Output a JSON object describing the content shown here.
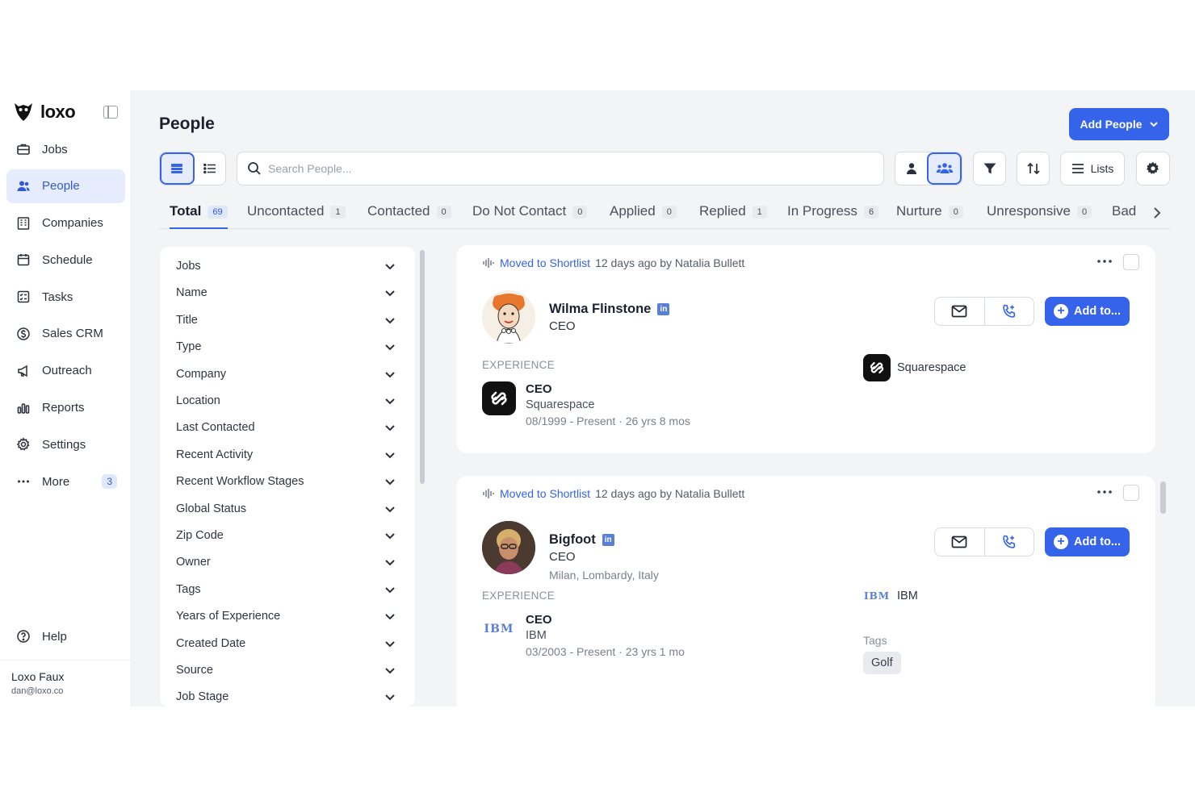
{
  "brand": {
    "name": "loxo"
  },
  "sidebar": {
    "items": [
      {
        "label": "Jobs",
        "icon": "briefcase-icon"
      },
      {
        "label": "People",
        "icon": "people-icon"
      },
      {
        "label": "Companies",
        "icon": "building-icon"
      },
      {
        "label": "Schedule",
        "icon": "calendar-icon"
      },
      {
        "label": "Tasks",
        "icon": "tasks-icon"
      },
      {
        "label": "Sales CRM",
        "icon": "dollar-icon"
      },
      {
        "label": "Outreach",
        "icon": "megaphone-icon"
      },
      {
        "label": "Reports",
        "icon": "bar-chart-icon"
      },
      {
        "label": "Settings",
        "icon": "gear-icon"
      },
      {
        "label": "More",
        "icon": "more-icon",
        "badge": "3"
      }
    ],
    "help": "Help",
    "user": {
      "name": "Loxo Faux",
      "email": "dan@loxo.co"
    }
  },
  "header": {
    "title": "People",
    "add_button": "Add People"
  },
  "toolbar": {
    "search_placeholder": "Search People...",
    "lists_label": "Lists"
  },
  "tabs": [
    {
      "label": "Total",
      "count": "69"
    },
    {
      "label": "Uncontacted",
      "count": "1"
    },
    {
      "label": "Contacted",
      "count": "0"
    },
    {
      "label": "Do Not Contact",
      "count": "0"
    },
    {
      "label": "Applied",
      "count": "0"
    },
    {
      "label": "Replied",
      "count": "1"
    },
    {
      "label": "In Progress",
      "count": "6"
    },
    {
      "label": "Nurture",
      "count": "0"
    },
    {
      "label": "Unresponsive",
      "count": "0"
    },
    {
      "label": "Bad",
      "count": ""
    }
  ],
  "filters": [
    "Jobs",
    "Name",
    "Title",
    "Type",
    "Company",
    "Location",
    "Last Contacted",
    "Recent Activity",
    "Recent Workflow Stages",
    "Global Status",
    "Zip Code",
    "Owner",
    "Tags",
    "Years of Experience",
    "Created Date",
    "Source",
    "Job Stage"
  ],
  "cards": [
    {
      "activity_action": "Moved to Shortlist",
      "activity_meta": "12 days ago by Natalia Bullett",
      "name": "Wilma Flinstone",
      "title": "CEO",
      "location": "",
      "add_label": "Add to...",
      "experience_label": "EXPERIENCE",
      "experience": {
        "role": "CEO",
        "company": "Squarespace",
        "dates": "08/1999 - Present · 26 yrs 8 mos"
      },
      "side_company": "Squarespace"
    },
    {
      "activity_action": "Moved to Shortlist",
      "activity_meta": "12 days ago by Natalia Bullett",
      "name": "Bigfoot",
      "title": "CEO",
      "location": "Milan, Lombardy, Italy",
      "add_label": "Add to...",
      "experience_label": "EXPERIENCE",
      "experience": {
        "role": "CEO",
        "company": "IBM",
        "dates": "03/2003 - Present · 23 yrs 1 mo"
      },
      "side_company": "IBM",
      "tags_label": "Tags",
      "tags": [
        "Golf"
      ]
    }
  ],
  "colors": {
    "accent": "#3563e9",
    "accent_soft": "#e6ecfb"
  }
}
